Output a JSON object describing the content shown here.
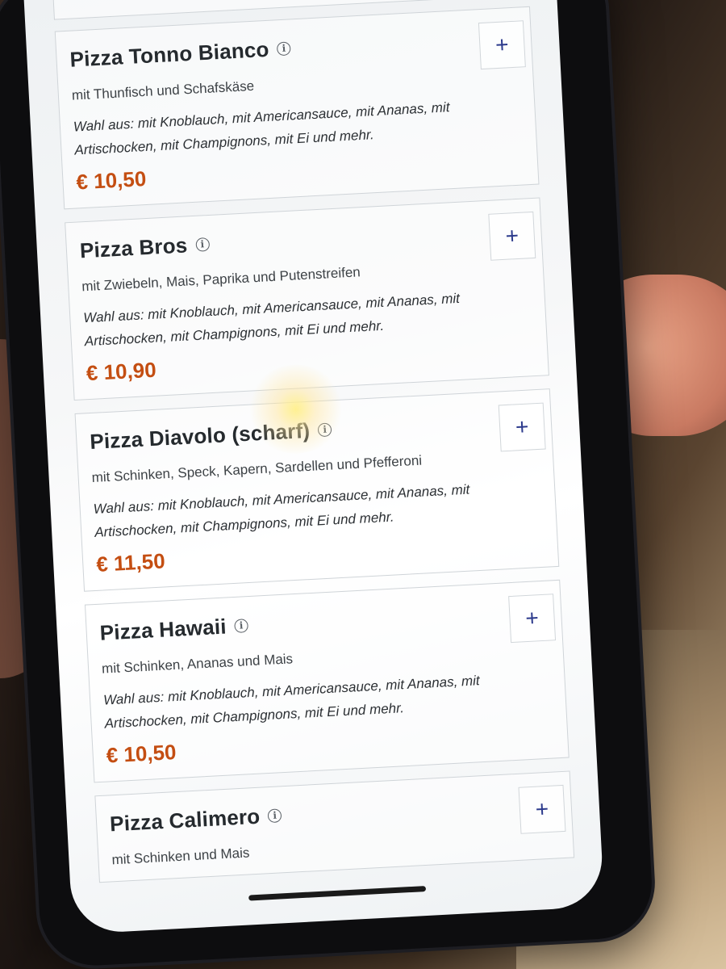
{
  "menu": {
    "items": [
      {
        "name": "Pizza Tonno Bianco",
        "description": "mit Thunfisch und Schafskäse",
        "options": "Wahl aus: mit Knoblauch, mit Americansauce, mit Ananas, mit Artischocken, mit Champignons, mit Ei und mehr.",
        "price": "€ 10,50"
      },
      {
        "name": "Pizza Bros",
        "description": "mit Zwiebeln, Mais, Paprika und Putenstreifen",
        "options": "Wahl aus: mit Knoblauch, mit Americansauce, mit Ananas, mit Artischocken, mit Champignons, mit Ei und mehr.",
        "price": "€ 10,90"
      },
      {
        "name": "Pizza Diavolo (scharf)",
        "description": "mit Schinken, Speck, Kapern, Sardellen und Pfefferoni",
        "options": "Wahl aus: mit Knoblauch, mit Americansauce, mit Ananas, mit Artischocken, mit Champignons, mit Ei und mehr.",
        "price": "€ 11,50"
      },
      {
        "name": "Pizza Hawaii",
        "description": "mit Schinken, Ananas und Mais",
        "options": "Wahl aus: mit Knoblauch, mit Americansauce, mit Ananas, mit Artischocken, mit Champignons, mit Ei und mehr.",
        "price": "€ 10,50"
      },
      {
        "name": "Pizza Calimero",
        "description": "mit Schinken und Mais"
      }
    ],
    "add_label": "+",
    "info_glyph": "i"
  },
  "colors": {
    "price": "#c44e12",
    "add_icon": "#2c3a8c",
    "title": "#252a2e"
  }
}
